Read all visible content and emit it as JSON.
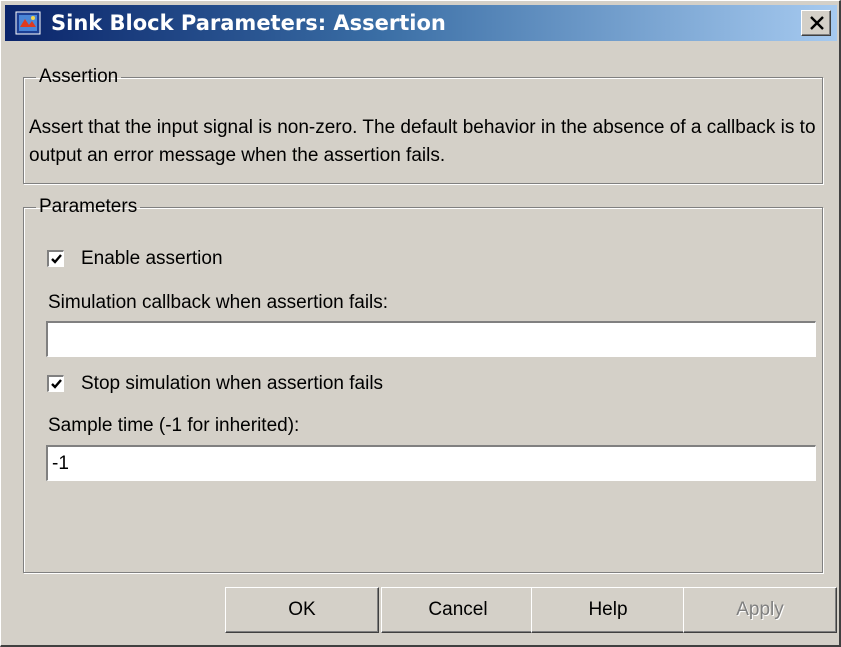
{
  "window": {
    "title": "Sink Block Parameters: Assertion",
    "icon": "simulink-block-icon",
    "close_icon": "close-icon"
  },
  "assertion": {
    "legend": "Assertion",
    "description": "Assert that the input signal is non-zero.  The default behavior in the absence of a callback is to output an error message when the assertion fails."
  },
  "parameters": {
    "legend": "Parameters",
    "enable_assertion": {
      "label": "Enable assertion",
      "checked": true
    },
    "callback": {
      "label": "Simulation callback when assertion fails:",
      "value": ""
    },
    "stop_simulation": {
      "label": "Stop simulation when assertion fails",
      "checked": true
    },
    "sample_time": {
      "label": "Sample time (-1 for inherited):",
      "value": "-1"
    }
  },
  "buttons": {
    "ok": "OK",
    "cancel": "Cancel",
    "help": "Help",
    "apply": "Apply"
  }
}
